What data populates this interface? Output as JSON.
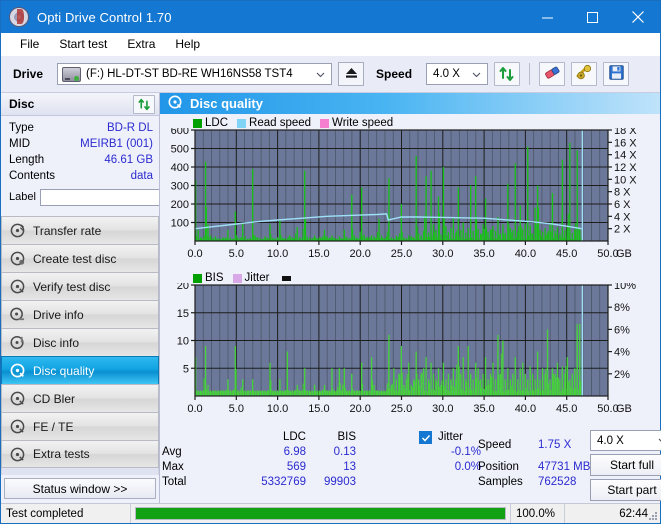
{
  "window": {
    "title": "Opti Drive Control 1.70",
    "minimize": "minimize-button",
    "maximize": "maximize-button",
    "close": "close-button"
  },
  "menu": {
    "items": [
      "File",
      "Start test",
      "Extra",
      "Help"
    ]
  },
  "toolbar": {
    "drive_label": "Drive",
    "drive_value": "(F:)  HL-DT-ST BD-RE  WH16NS58 TST4",
    "eject_title": "Eject",
    "speed_label": "Speed",
    "speed_value": "4.0 X",
    "refresh_title": "Refresh",
    "erase_title": "Erase",
    "tools_title": "Tools",
    "save_title": "Save"
  },
  "disc": {
    "header": "Disc",
    "rows": [
      {
        "key": "Type",
        "value": "BD-R DL"
      },
      {
        "key": "MID",
        "value": "MEIRB1 (001)"
      },
      {
        "key": "Length",
        "value": "46.61 GB"
      },
      {
        "key": "Contents",
        "value": "data"
      }
    ],
    "label_key": "Label",
    "label_value": ""
  },
  "nav": {
    "items": [
      {
        "label": "Transfer rate",
        "active": false
      },
      {
        "label": "Create test disc",
        "active": false
      },
      {
        "label": "Verify test disc",
        "active": false
      },
      {
        "label": "Drive info",
        "active": false
      },
      {
        "label": "Disc info",
        "active": false
      },
      {
        "label": "Disc quality",
        "active": true
      },
      {
        "label": "CD Bler",
        "active": false
      },
      {
        "label": "FE / TE",
        "active": false
      },
      {
        "label": "Extra tests",
        "active": false
      }
    ],
    "status_window": "Status window >>"
  },
  "main": {
    "title": "Disc quality"
  },
  "chart_data": [
    {
      "type": "bar",
      "title": "Disc quality - LDC",
      "legend": [
        {
          "name": "LDC",
          "color": "#00a000"
        },
        {
          "name": "Read speed",
          "color": "#7fd4f5"
        },
        {
          "name": "Write speed",
          "color": "#f77fd0"
        }
      ],
      "legend_position": "top-left",
      "xlabel": "GB",
      "xticks": [
        "0.0",
        "5.0",
        "10.0",
        "15.0",
        "20.0",
        "25.0",
        "30.0",
        "35.0",
        "40.0",
        "45.0",
        "50.0"
      ],
      "xlim": [
        0,
        50
      ],
      "ylabel_left": "LDC",
      "yticks_left": [
        "100",
        "200",
        "300",
        "400",
        "500",
        "600"
      ],
      "ylim_left": [
        0,
        600
      ],
      "ylabel_right": "Speed",
      "yticks_right": [
        "2 X",
        "4 X",
        "6 X",
        "8 X",
        "10 X",
        "12 X",
        "14 X",
        "16 X",
        "18 X"
      ],
      "ylim_right": [
        0,
        18
      ],
      "grid": true,
      "plot_bg": "#6b7899",
      "series": [
        {
          "name": "LDC",
          "color": "#18c018",
          "x": [
            0.0,
            0.3,
            0.6,
            0.9,
            1.2,
            1.5,
            1.8,
            2.1,
            2.4,
            2.7,
            3.0,
            3.3,
            3.6,
            3.9,
            4.2,
            4.5,
            4.8,
            5.1,
            5.4,
            5.7,
            6.0,
            6.3,
            6.6,
            6.9,
            7.2,
            7.5,
            7.8,
            8.1,
            8.4,
            8.7,
            9.0,
            9.3,
            9.6,
            9.9,
            10.2,
            10.5,
            10.8,
            11.1,
            11.4,
            11.7,
            12.0,
            12.3,
            12.6,
            12.9,
            13.2,
            13.5,
            13.8,
            14.1,
            14.4,
            14.7,
            15.0,
            15.3,
            15.6,
            15.9,
            16.2,
            16.5,
            16.8,
            17.1,
            17.4,
            17.7,
            18.0,
            18.3,
            18.6,
            18.9,
            19.2,
            19.5,
            19.8,
            20.1,
            20.4,
            20.7,
            21.0,
            21.3,
            21.6,
            21.9,
            22.2,
            22.5,
            22.8,
            23.1,
            23.4,
            23.7,
            24.0,
            24.3,
            24.6,
            24.9,
            25.2,
            25.5,
            25.8,
            26.1,
            26.4,
            26.7,
            27.0,
            27.3,
            27.6,
            27.9,
            28.2,
            28.5,
            28.8,
            29.1,
            29.4,
            29.7,
            30.0,
            30.3,
            30.6,
            30.9,
            31.2,
            31.5,
            31.8,
            32.1,
            32.4,
            32.7,
            33.0,
            33.3,
            33.6,
            33.9,
            34.2,
            34.5,
            34.8,
            35.1,
            35.4,
            35.7,
            36.0,
            36.3,
            36.6,
            36.9,
            37.2,
            37.5,
            37.8,
            38.1,
            38.4,
            38.7,
            39.0,
            39.3,
            39.6,
            39.9,
            40.2,
            40.5,
            40.8,
            41.1,
            41.4,
            41.7,
            42.0,
            42.3,
            42.6,
            42.9,
            43.2,
            43.5,
            43.8,
            44.1,
            44.4,
            44.7,
            45.0,
            45.3,
            45.6,
            45.9,
            46.2,
            46.5,
            46.8
          ],
          "values": [
            330,
            60,
            20,
            15,
            430,
            90,
            30,
            18,
            25,
            15,
            12,
            20,
            15,
            60,
            18,
            12,
            160,
            20,
            15,
            95,
            25,
            12,
            18,
            390,
            30,
            18,
            15,
            12,
            25,
            18,
            90,
            15,
            12,
            20,
            110,
            18,
            15,
            12,
            30,
            18,
            15,
            75,
            20,
            15,
            380,
            25,
            18,
            12,
            30,
            15,
            20,
            18,
            60,
            25,
            15,
            30,
            18,
            12,
            25,
            15,
            60,
            20,
            15,
            250,
            30,
            18,
            15,
            290,
            35,
            20,
            15,
            30,
            25,
            18,
            120,
            30,
            15,
            25,
            340,
            20,
            15,
            30,
            25,
            200,
            18,
            15,
            30,
            25,
            20,
            460,
            40,
            30,
            55,
            350,
            45,
            380,
            90,
            60,
            240,
            35,
            400,
            80,
            50,
            70,
            130,
            45,
            290,
            60,
            100,
            45,
            70,
            300,
            55,
            350,
            65,
            40,
            90,
            230,
            50,
            60,
            80,
            55,
            130,
            40,
            90,
            45,
            310,
            70,
            60,
            420,
            50,
            190,
            65,
            95,
            510,
            85,
            40,
            180,
            300,
            60,
            50,
            70,
            45,
            90,
            260,
            55,
            75,
            40,
            440,
            60,
            80,
            530,
            45,
            60,
            490,
            70,
            50,
            520,
            560,
            480,
            60
          ]
        },
        {
          "name": "Read speed",
          "color": "#9fe0f7",
          "x": [
            0.0,
            2.0,
            4.0,
            6.0,
            8.0,
            10.0,
            12.0,
            14.0,
            16.0,
            18.0,
            20.0,
            22.0,
            23.2,
            23.4,
            25.0,
            27.0,
            29.0,
            31.0,
            33.0,
            35.0,
            37.0,
            39.0,
            41.0,
            43.0,
            45.0,
            46.8
          ],
          "values": [
            2.0,
            2.3,
            2.6,
            2.9,
            3.2,
            3.4,
            3.6,
            3.8,
            4.0,
            4.1,
            4.2,
            4.3,
            4.4,
            3.4,
            3.9,
            3.9,
            3.85,
            3.8,
            3.75,
            3.7,
            3.5,
            3.3,
            3.1,
            2.8,
            2.4,
            2.0
          ],
          "axis": "right"
        }
      ],
      "end_marker": {
        "x": 46.9,
        "color": "#9fe0f7"
      }
    },
    {
      "type": "bar",
      "title": "Disc quality - BIS",
      "legend": [
        {
          "name": "BIS",
          "color": "#00a000"
        },
        {
          "name": "Jitter",
          "color": "#d8a8e8"
        }
      ],
      "legend_position": "top-left",
      "xlabel": "GB",
      "xticks": [
        "0.0",
        "5.0",
        "10.0",
        "15.0",
        "20.0",
        "25.0",
        "30.0",
        "35.0",
        "40.0",
        "45.0",
        "50.0"
      ],
      "xlim": [
        0,
        50
      ],
      "ylabel_left": "BIS",
      "yticks_left": [
        "5",
        "10",
        "15",
        "20"
      ],
      "ylim_left": [
        0,
        20
      ],
      "ylabel_right": "Jitter",
      "yticks_right": [
        "2%",
        "4%",
        "6%",
        "8%",
        "10%"
      ],
      "ylim_right": [
        0,
        10
      ],
      "grid": true,
      "plot_bg": "#6b7899",
      "series": [
        {
          "name": "BIS",
          "color": "#46d23a",
          "x": [
            0.0,
            0.3,
            0.6,
            0.9,
            1.2,
            1.5,
            1.8,
            2.1,
            2.4,
            2.7,
            3.0,
            3.3,
            3.6,
            3.9,
            4.2,
            4.5,
            4.8,
            5.1,
            5.4,
            5.7,
            6.0,
            6.3,
            6.6,
            6.9,
            7.2,
            7.5,
            7.8,
            8.1,
            8.4,
            8.7,
            9.0,
            9.3,
            9.6,
            9.9,
            10.2,
            10.5,
            10.8,
            11.1,
            11.4,
            11.7,
            12.0,
            12.3,
            12.6,
            12.9,
            13.2,
            13.5,
            13.8,
            14.1,
            14.4,
            14.7,
            15.0,
            15.3,
            15.6,
            15.9,
            16.2,
            16.5,
            16.8,
            17.1,
            17.4,
            17.7,
            18.0,
            18.3,
            18.6,
            18.9,
            19.2,
            19.5,
            19.8,
            20.1,
            20.4,
            20.7,
            21.0,
            21.3,
            21.6,
            21.9,
            22.2,
            22.5,
            22.8,
            23.1,
            23.4,
            23.7,
            24.0,
            24.3,
            24.6,
            24.9,
            25.2,
            25.5,
            25.8,
            26.1,
            26.4,
            26.7,
            27.0,
            27.3,
            27.6,
            27.9,
            28.2,
            28.5,
            28.8,
            29.1,
            29.4,
            29.7,
            30.0,
            30.3,
            30.6,
            30.9,
            31.2,
            31.5,
            31.8,
            32.1,
            32.4,
            32.7,
            33.0,
            33.3,
            33.6,
            33.9,
            34.2,
            34.5,
            34.8,
            35.1,
            35.4,
            35.7,
            36.0,
            36.3,
            36.6,
            36.9,
            37.2,
            37.5,
            37.8,
            38.1,
            38.4,
            38.7,
            39.0,
            39.3,
            39.6,
            39.9,
            40.2,
            40.5,
            40.8,
            41.1,
            41.4,
            41.7,
            42.0,
            42.3,
            42.6,
            42.9,
            43.2,
            43.5,
            43.8,
            44.1,
            44.4,
            44.7,
            45.0,
            45.3,
            45.6,
            45.9,
            46.2,
            46.5,
            46.8
          ],
          "values": [
            7,
            1,
            1,
            1,
            9,
            2,
            1,
            1,
            1,
            1,
            1,
            1,
            1,
            3,
            1,
            1,
            9,
            1,
            1,
            3,
            1,
            1,
            1,
            3,
            1,
            1,
            1,
            1,
            1,
            1,
            6,
            1,
            1,
            1,
            3,
            1,
            1,
            8,
            1,
            1,
            1,
            2,
            1,
            1,
            5,
            1,
            1,
            1,
            2,
            1,
            1,
            1,
            2,
            1,
            1,
            5,
            1,
            1,
            5,
            1,
            5,
            1,
            1,
            4,
            1,
            1,
            1,
            6,
            1,
            1,
            1,
            7,
            2,
            1,
            1,
            1,
            1,
            1,
            11,
            2,
            5,
            3,
            4,
            9,
            2,
            3,
            6,
            2,
            3,
            8,
            3,
            4,
            5,
            7,
            3,
            6,
            4,
            3,
            5,
            2,
            6,
            3,
            4,
            3,
            5,
            3,
            9,
            4,
            7,
            3,
            9,
            4,
            3,
            6,
            5,
            3,
            4,
            7,
            3,
            4,
            6,
            3,
            11,
            4,
            10,
            3,
            5,
            3,
            4,
            7,
            3,
            5,
            6,
            4,
            3,
            5,
            4,
            3,
            8,
            3,
            5,
            4,
            12,
            3,
            5,
            4,
            6,
            3,
            5,
            4,
            7,
            3,
            4,
            5,
            12,
            13,
            7
          ]
        }
      ],
      "end_marker": {
        "x": 46.9,
        "color": "#9fe0f7"
      }
    }
  ],
  "stats": {
    "columns": [
      "LDC",
      "BIS"
    ],
    "jitter_label": "Jitter",
    "jitter_checked": true,
    "rows": [
      {
        "label": "Avg",
        "ldc": "6.98",
        "bis": "0.13",
        "jitter": "-0.1%"
      },
      {
        "label": "Max",
        "ldc": "569",
        "bis": "13",
        "jitter": "0.0%"
      },
      {
        "label": "Total",
        "ldc": "5332769",
        "bis": "99903",
        "jitter": ""
      }
    ],
    "speed_label": "Speed",
    "speed_value": "1.75 X",
    "position_label": "Position",
    "position_value": "47731 MB",
    "samples_label": "Samples",
    "samples_value": "762528",
    "speed_select": "4.0 X",
    "start_full": "Start full",
    "start_part": "Start part"
  },
  "statusbar": {
    "message": "Test completed",
    "progress_percent": "100.0%",
    "progress_value": 100,
    "elapsed": "62:44"
  },
  "colors": {
    "accent": "#1477d1",
    "value_text": "#2b2bd0",
    "plot_bg": "#6b7899",
    "ldc_green": "#18c018",
    "read_speed": "#9fe0f7",
    "write_speed": "#f77fd0",
    "progress_green": "#12a112"
  }
}
